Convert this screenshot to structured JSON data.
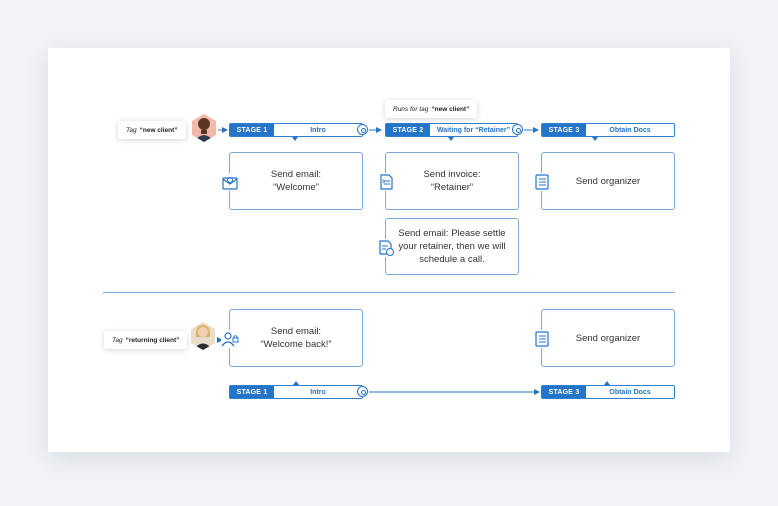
{
  "colors": {
    "accent": "#2474c9",
    "card_border": "#7ea9d8",
    "canvas": "#ffffff",
    "page": "#f1f3f6"
  },
  "row1": {
    "tag": {
      "prefix": "Tag",
      "value": "“new client”"
    },
    "stages": [
      {
        "badge": "STAGE 1",
        "name": "Intro"
      },
      {
        "badge": "STAGE 2",
        "name": "Waiting for “Retainer”"
      },
      {
        "badge": "STAGE 3",
        "name": "Obtain Docs"
      }
    ],
    "runs_tag": {
      "prefix": "Runs for tag",
      "value": "“new client”"
    },
    "cards": [
      {
        "text": "Send email:\n“Welcome”",
        "icon": "email-icon"
      },
      {
        "text": "Send invoice:\n“Retainer”",
        "icon": "invoice-icon"
      },
      {
        "text": "Send organizer",
        "icon": "organizer-icon"
      },
      {
        "text": "Send email: Please settle\nyour retainer, then we will\nschedule a call.",
        "icon": "email-doc-icon"
      }
    ]
  },
  "row2": {
    "tag": {
      "prefix": "Tag",
      "value": "“returning client”"
    },
    "cards": [
      {
        "text": "Send email:\n“Welcome back!”",
        "icon": "user-lock-icon"
      },
      {
        "text": "Send organizer",
        "icon": "organizer-icon"
      }
    ],
    "stages": [
      {
        "badge": "STAGE 1",
        "name": "Intro"
      },
      {
        "badge": "STAGE 3",
        "name": "Obtain Docs"
      }
    ]
  }
}
